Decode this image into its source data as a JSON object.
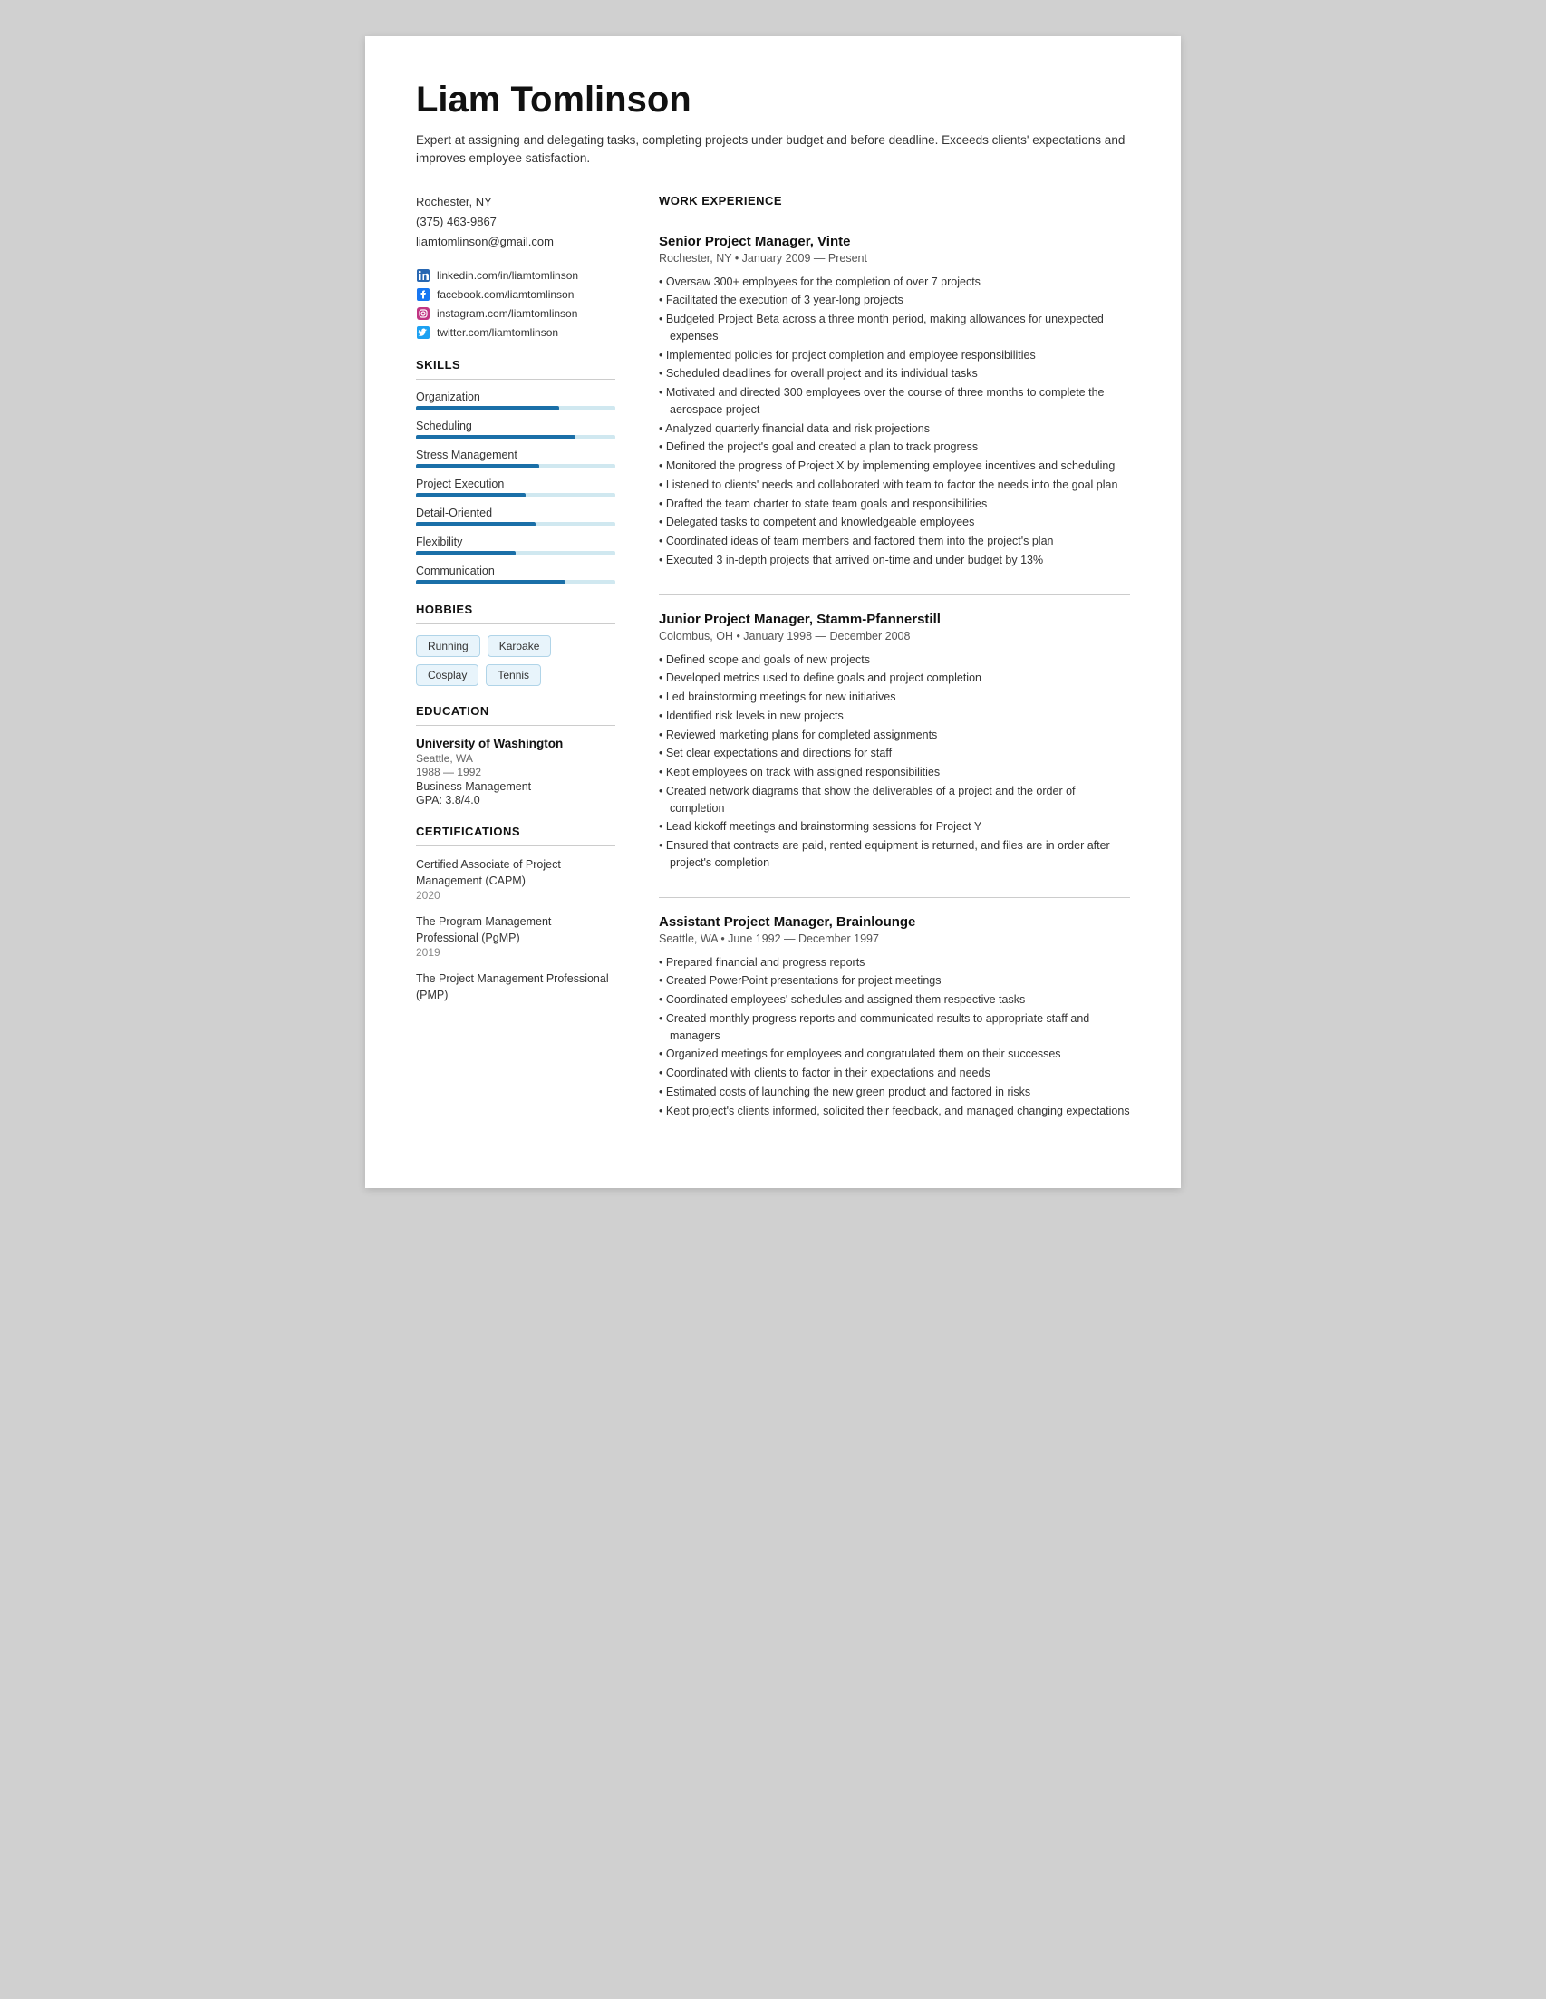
{
  "header": {
    "name": "Liam Tomlinson",
    "summary": "Expert at assigning and delegating tasks, completing projects under budget and before deadline. Exceeds clients' expectations and improves employee satisfaction."
  },
  "contact": {
    "location": "Rochester, NY",
    "phone": "(375) 463-9867",
    "email": "liamtomlinson@gmail.com"
  },
  "social": [
    {
      "icon": "linkedin",
      "text": "linkedin.com/in/liamtomlinson"
    },
    {
      "icon": "facebook",
      "text": "facebook.com/liamtomlinson"
    },
    {
      "icon": "instagram",
      "text": "instagram.com/liamtomlinson"
    },
    {
      "icon": "twitter",
      "text": "twitter.com/liamtomlinson"
    }
  ],
  "skills_title": "SKILLS",
  "skills": [
    {
      "name": "Organization",
      "pct": 72
    },
    {
      "name": "Scheduling",
      "pct": 80
    },
    {
      "name": "Stress Management",
      "pct": 62
    },
    {
      "name": "Project Execution",
      "pct": 55
    },
    {
      "name": "Detail-Oriented",
      "pct": 60
    },
    {
      "name": "Flexibility",
      "pct": 50
    },
    {
      "name": "Communication",
      "pct": 75
    }
  ],
  "hobbies_title": "HOBBIES",
  "hobbies": [
    "Running",
    "Karoake",
    "Cosplay",
    "Tennis"
  ],
  "education_title": "EDUCATION",
  "education": [
    {
      "institution": "University of Washington",
      "location": "Seattle, WA",
      "years": "1988 — 1992",
      "field": "Business Management",
      "gpa": "GPA: 3.8/4.0"
    }
  ],
  "certifications_title": "CERTIFICATIONS",
  "certifications": [
    {
      "name": "Certified Associate of Project Management (CAPM)",
      "year": "2020"
    },
    {
      "name": "The Program Management Professional (PgMP)",
      "year": "2019"
    },
    {
      "name": "The Project Management Professional (PMP)",
      "year": ""
    }
  ],
  "work_title": "WORK EXPERIENCE",
  "jobs": [
    {
      "title": "Senior Project Manager, Vinte",
      "meta": "Rochester, NY • January 2009 — Present",
      "bullets": [
        "Oversaw 300+ employees for the completion of over 7 projects",
        "Facilitated the execution of 3 year-long projects",
        "Budgeted Project Beta across a three month period, making allowances for unexpected expenses",
        "Implemented policies for project completion and employee responsibilities",
        "Scheduled deadlines for overall project and its individual tasks",
        "Motivated and directed 300 employees over the course of three months to complete the aerospace project",
        "Analyzed quarterly financial data and risk projections",
        "Defined the project's goal and created a plan to track progress",
        "Monitored the progress of Project X by implementing employee incentives and scheduling",
        "Listened to clients' needs and collaborated with team to factor the needs into the goal plan",
        "Drafted the team charter to state team goals and responsibilities",
        "Delegated tasks to competent and knowledgeable employees",
        "Coordinated ideas of team members and factored them into the project's plan",
        "Executed 3 in-depth projects that arrived on-time and under budget by 13%"
      ]
    },
    {
      "title": "Junior Project Manager, Stamm-Pfannerstill",
      "meta": "Colombus, OH • January 1998 — December 2008",
      "bullets": [
        "Defined scope and goals of new projects",
        "Developed metrics used to define goals and project completion",
        "Led brainstorming meetings for new initiatives",
        "Identified risk levels in new projects",
        "Reviewed marketing plans for completed assignments",
        "Set clear expectations and directions for staff",
        "Kept employees on track with assigned responsibilities",
        "Created network diagrams that show the deliverables of a project and the order of completion",
        "Lead kickoff meetings and brainstorming sessions for Project Y",
        "Ensured that contracts are paid, rented equipment is returned, and files are in order after project's completion"
      ]
    },
    {
      "title": "Assistant Project Manager, Brainlounge",
      "meta": "Seattle, WA • June 1992 — December 1997",
      "bullets": [
        "Prepared financial and progress reports",
        "Created PowerPoint presentations for project meetings",
        "Coordinated employees' schedules and assigned them respective tasks",
        "Created monthly progress reports and communicated results to appropriate staff and managers",
        "Organized meetings for employees and congratulated them on their successes",
        "Coordinated with clients to factor in their expectations and needs",
        "Estimated costs of launching the new green product and factored in risks",
        "Kept project's clients informed, solicited their feedback, and managed changing expectations"
      ]
    }
  ]
}
